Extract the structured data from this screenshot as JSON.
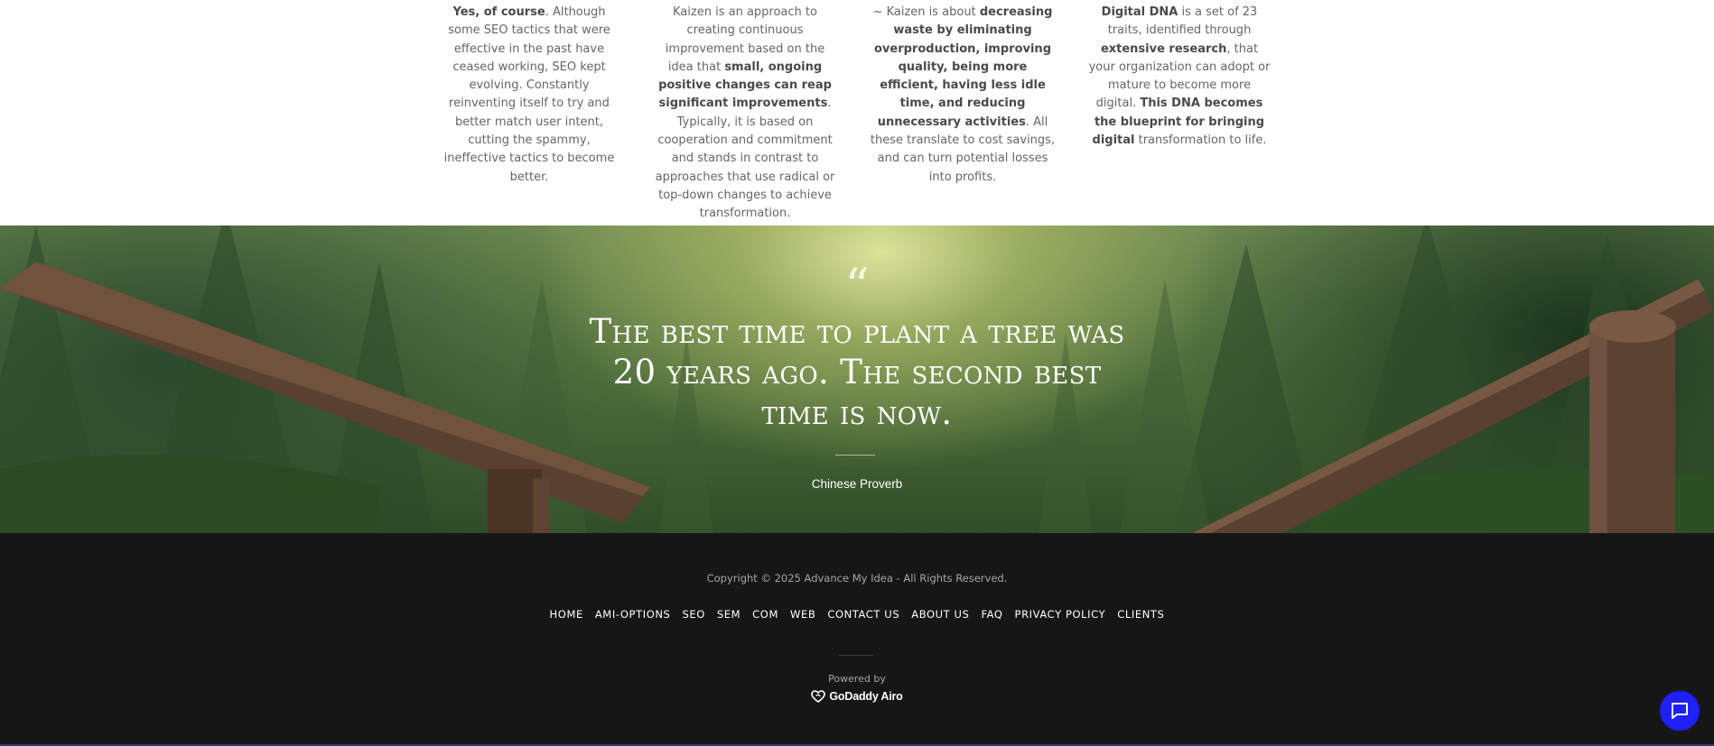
{
  "columns": [
    {
      "parts": [
        {
          "bold": true,
          "text": "Yes, of course"
        },
        {
          "bold": false,
          "text": ". Although some SEO tactics that were effective in the past have ceased working, SEO kept evolving. Constantly reinventing itself to try and better match user intent, cutting the spammy, ineffective tactics to become better."
        }
      ]
    },
    {
      "parts": [
        {
          "bold": false,
          "text": "Kaizen is an approach to creating continuous improvement based on the idea that "
        },
        {
          "bold": true,
          "text": "small, ongoing positive changes can reap significant improvements"
        },
        {
          "bold": false,
          "text": ". Typically, it is based on cooperation and commitment and stands in contrast to approaches that use radical or top-down changes to achieve transformation."
        }
      ]
    },
    {
      "parts": [
        {
          "bold": false,
          "text": "~ Kaizen is about "
        },
        {
          "bold": true,
          "text": "decreasing waste by eliminating overproduction, improving quality, being more efficient, having less idle time, and reducing unnecessary activities"
        },
        {
          "bold": false,
          "text": ". All these translate to cost savings, and can turn potential losses into profits."
        }
      ]
    },
    {
      "parts": [
        {
          "bold": true,
          "text": "Digital DNA"
        },
        {
          "bold": false,
          "text": " is a set of 23 traits, identified through "
        },
        {
          "bold": true,
          "text": "extensive research"
        },
        {
          "bold": false,
          "text": ", that your organization can adopt or mature to become more digital. "
        },
        {
          "bold": true,
          "text": "This DNA becomes the blueprint for bringing digital"
        },
        {
          "bold": false,
          "text": " transformation to life."
        }
      ]
    }
  ],
  "quote": {
    "mark": "“",
    "text": "The best time to plant a tree was 20 years ago. The second best time is now.",
    "author": "Chinese Proverb"
  },
  "footer": {
    "copyright": "Copyright © 2025 Advance My Idea - All Rights Reserved.",
    "nav": [
      "HOME",
      "AMI-OPTIONS",
      "SEO",
      "SEM",
      "COM",
      "WEB",
      "CONTACT US",
      "ABOUT US",
      "FAQ",
      "PRIVACY POLICY",
      "CLIENTS"
    ],
    "powered_by": "Powered by",
    "brand": "GoDaddy Airo",
    "brand_icon": "godaddy-heart-icon"
  },
  "chat": {
    "icon": "chat-bubble-icon",
    "color": "#1f20ff"
  },
  "colors": {
    "footer_bg": "#161616",
    "body_text": "#666666"
  }
}
